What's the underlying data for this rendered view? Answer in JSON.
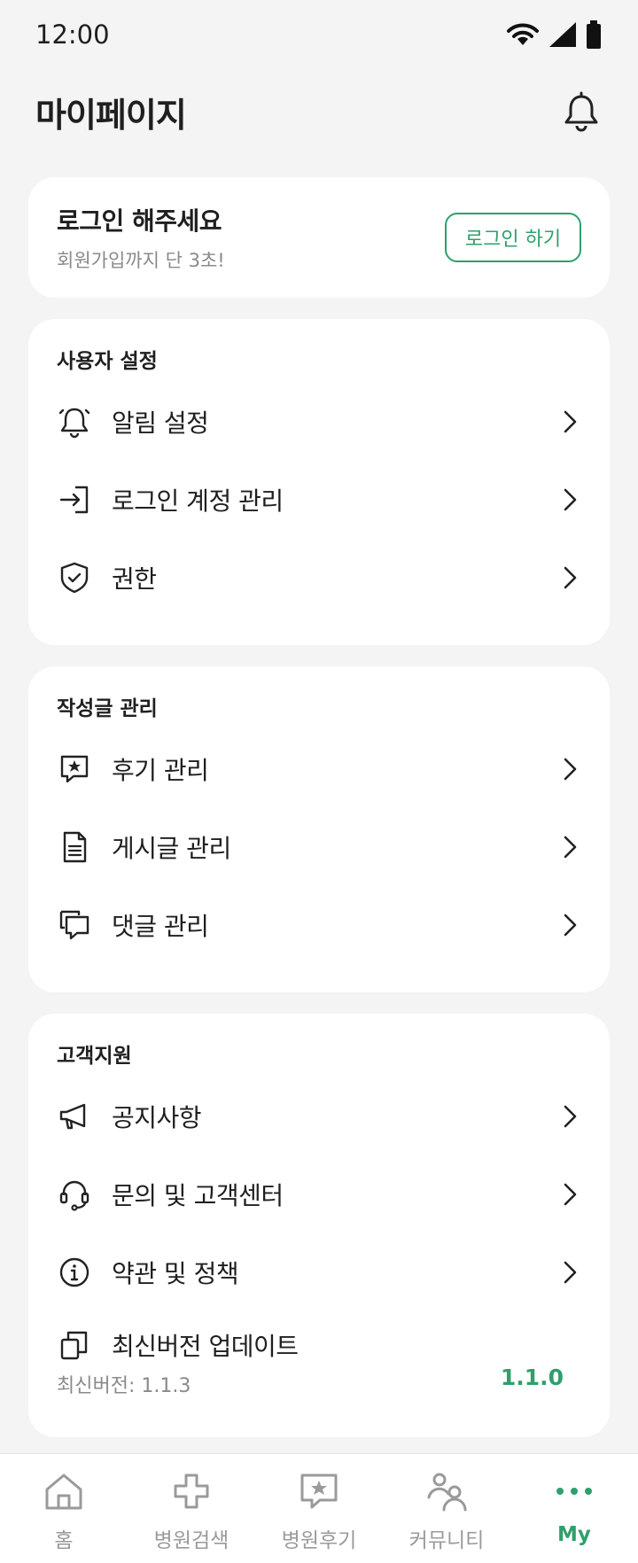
{
  "status": {
    "time": "12:00"
  },
  "header": {
    "title": "마이페이지"
  },
  "login_card": {
    "title": "로그인 해주세요",
    "subtitle": "회원가입까지 단 3초!",
    "button": "로그인 하기"
  },
  "sections": {
    "user_settings": {
      "title": "사용자 설정",
      "items": [
        {
          "label": "알림 설정",
          "icon": "bell-icon"
        },
        {
          "label": "로그인 계정 관리",
          "icon": "login-icon"
        },
        {
          "label": "권한",
          "icon": "shield-check-icon"
        }
      ]
    },
    "posts": {
      "title": "작성글 관리",
      "items": [
        {
          "label": "후기 관리",
          "icon": "review-star-icon"
        },
        {
          "label": "게시글 관리",
          "icon": "document-icon"
        },
        {
          "label": "댓글 관리",
          "icon": "comments-icon"
        }
      ]
    },
    "support": {
      "title": "고객지원",
      "items": [
        {
          "label": "공지사항",
          "icon": "megaphone-icon"
        },
        {
          "label": "문의 및 고객센터",
          "icon": "headset-icon"
        },
        {
          "label": "약관 및 정책",
          "icon": "info-icon"
        },
        {
          "label": "최신버전 업데이트",
          "icon": "copy-icon",
          "value": "1.1.0",
          "sub": "최신버전: 1.1.3"
        }
      ]
    }
  },
  "tabbar": {
    "tabs": [
      {
        "label": "홈",
        "icon": "home-icon"
      },
      {
        "label": "병원검색",
        "icon": "hospital-cross-icon"
      },
      {
        "label": "병원후기",
        "icon": "review-star-icon"
      },
      {
        "label": "커뮤니티",
        "icon": "people-icon"
      },
      {
        "label": "My",
        "icon": "more-dots-icon"
      }
    ],
    "active": "My"
  },
  "colors": {
    "accent": "#2ea06b",
    "background": "#f4f4f4",
    "card": "#ffffff"
  }
}
